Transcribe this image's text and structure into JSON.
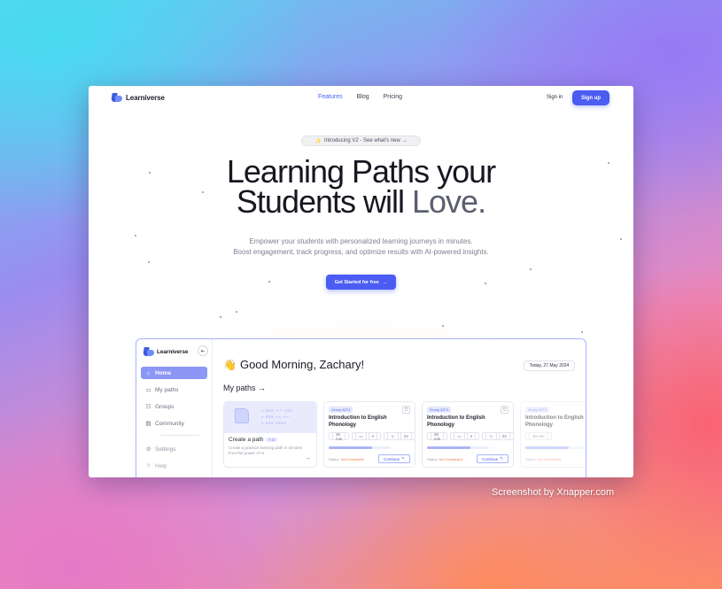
{
  "nav": {
    "brand": "Learniverse",
    "links": [
      "Features",
      "Blog",
      "Pricing"
    ],
    "signin": "Sign in",
    "signup": "Sign up"
  },
  "hero": {
    "pill": "Introducing V2 - See what's new →",
    "title_line1": "Learning Paths your",
    "title_line2a": "Students will ",
    "title_line2b": "Love.",
    "subtitle_line1": "Empower your students with personalized learning journeys in minutes.",
    "subtitle_line2": "Boost engagement, track progress, and optimize results with AI-powered insights.",
    "cta": "Get Started for free",
    "cta_arrow": "→"
  },
  "app": {
    "brand": "Learniverse",
    "collapse_icon": "⇤",
    "sidebar": [
      {
        "icon": "⌂",
        "label": "Home"
      },
      {
        "icon": "⚏",
        "label": "My paths"
      },
      {
        "icon": "☷",
        "label": "Groups"
      },
      {
        "icon": "▤",
        "label": "Community"
      },
      {
        "icon": "⚙",
        "label": "Settings"
      },
      {
        "icon": "?",
        "label": "Help"
      }
    ],
    "greeting": "Good Morning, Zachary!",
    "greeting_icon": "👋",
    "date": "Today, 27 May 2024",
    "my_paths": "My paths →",
    "create": {
      "title": "Create a path",
      "badge": "+ 2",
      "desc": "Create a practice learning path in minutes from the power of AI",
      "arrow": "→",
      "sketch_lines": [
        "≈ ≡≡≡ ∼∼ ≈≡≡",
        "≈ ≡≡≡ ∼≈ ≈∼",
        "≈ ≡≡≡ ≡≡≡≡"
      ]
    },
    "paths": [
      {
        "group": "Group 8274",
        "title": "Introduction to English Phonology",
        "duration": "30 min",
        "lessons": "4",
        "students": "23",
        "status_label": "Status:",
        "status": "Not Scheduled",
        "progress": 0.7,
        "continue": "Continue"
      },
      {
        "group": "Group 8274",
        "title": "Introduction to English Phonology",
        "duration": "30 min",
        "lessons": "4",
        "students": "23",
        "status_label": "Status:",
        "status": "Not Scheduled",
        "progress": 0.7,
        "continue": "Continue"
      },
      {
        "group": "Group 8274",
        "title": "Introduction to English Phonology",
        "duration": "30 min",
        "lessons": "4",
        "students": "23",
        "status_label": "Status:",
        "status": "Not Scheduled",
        "progress": 0.7,
        "continue": "Continue"
      }
    ]
  },
  "credit": "Screenshot by Xnapper.com",
  "colors": {
    "accent": "#4b5cf0",
    "sidebar_active": "#8b96f5",
    "status_warning": "#f07a48"
  }
}
